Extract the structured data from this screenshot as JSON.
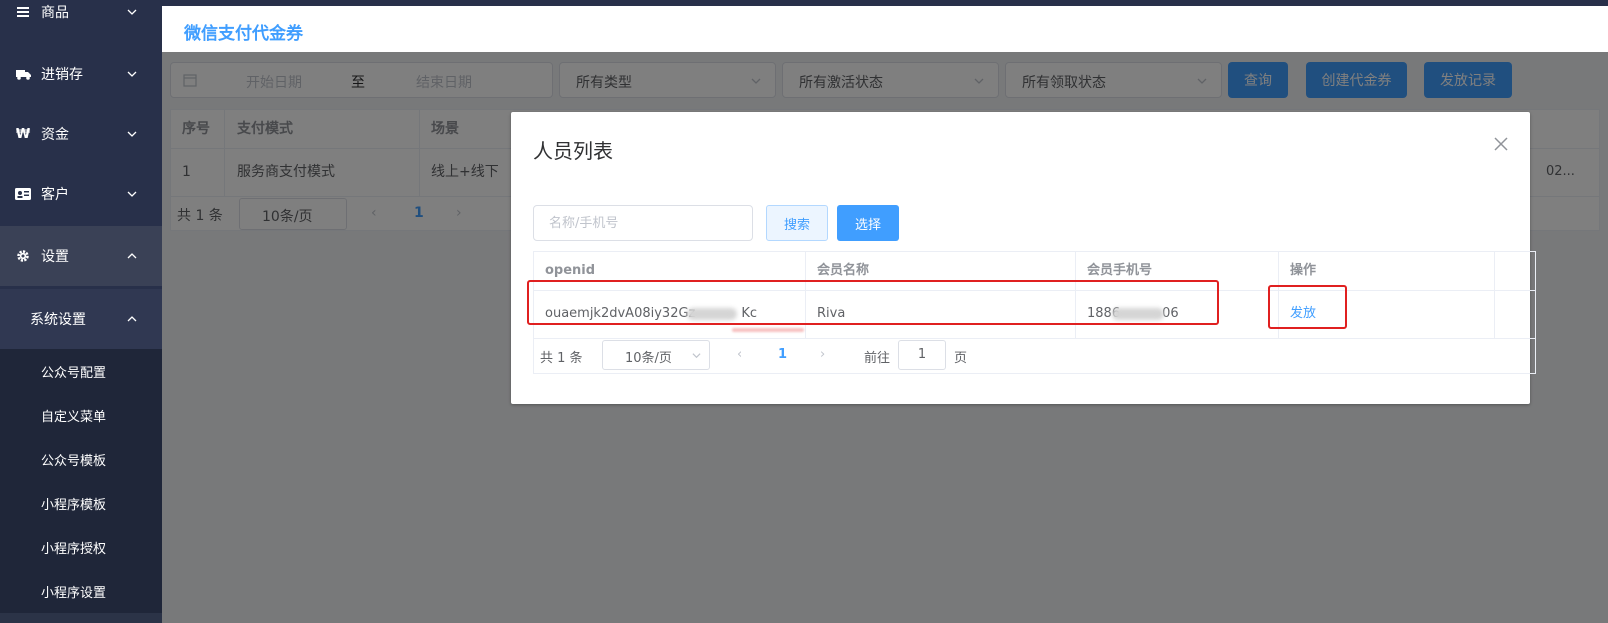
{
  "sidebar": {
    "items": [
      {
        "label": "商品",
        "icon": "list-icon"
      },
      {
        "label": "进销存",
        "icon": "truck-icon"
      },
      {
        "label": "资金",
        "icon": "won-icon"
      },
      {
        "label": "客户",
        "icon": "id-card-icon"
      },
      {
        "label": "设置",
        "icon": "gear-icon"
      }
    ],
    "submenu_title": "系统设置",
    "sub_items": [
      "公众号配置",
      "自定义菜单",
      "公众号模板",
      "小程序模板",
      "小程序授权",
      "小程序设置"
    ]
  },
  "header": {
    "title": "微信支付代金券"
  },
  "filters": {
    "start_placeholder": "开始日期",
    "separator": "至",
    "end_placeholder": "结束日期",
    "type_select": "所有类型",
    "activation_select": "所有激活状态",
    "claim_select": "所有领取状态",
    "query_button": "查询",
    "create_button": "创建代金券",
    "records_button": "发放记录"
  },
  "bg_table": {
    "columns": [
      "序号",
      "支付模式",
      "场景"
    ],
    "rows": [
      {
        "index": "1",
        "mode": "服务商支付模式",
        "scene": "线上+线下"
      }
    ],
    "truncated_cell": "02...",
    "pager": {
      "total": "共 1 条",
      "page_size": "10条/页",
      "current": "1"
    }
  },
  "dialog": {
    "title": "人员列表",
    "search_placeholder": "名称/手机号",
    "search_button": "搜索",
    "select_button": "选择",
    "columns": [
      "openid",
      "会员名称",
      "会员手机号",
      "操作"
    ],
    "rows": [
      {
        "openid": "ouaemjk2dvA08iy32Gz",
        "openid_tail": "Kc",
        "name": "Riva",
        "phone_head": "1886",
        "phone_tail": "06",
        "action": "发放"
      }
    ],
    "pager": {
      "total": "共 1 条",
      "page_size": "10条/页",
      "prev": "‹",
      "current": "1",
      "next": "›",
      "goto_label": "前往",
      "goto_value": "1",
      "page_unit": "页"
    }
  },
  "colors": {
    "primary": "#409eff",
    "sidebar": "#28304a",
    "highlight": "#e02020"
  }
}
